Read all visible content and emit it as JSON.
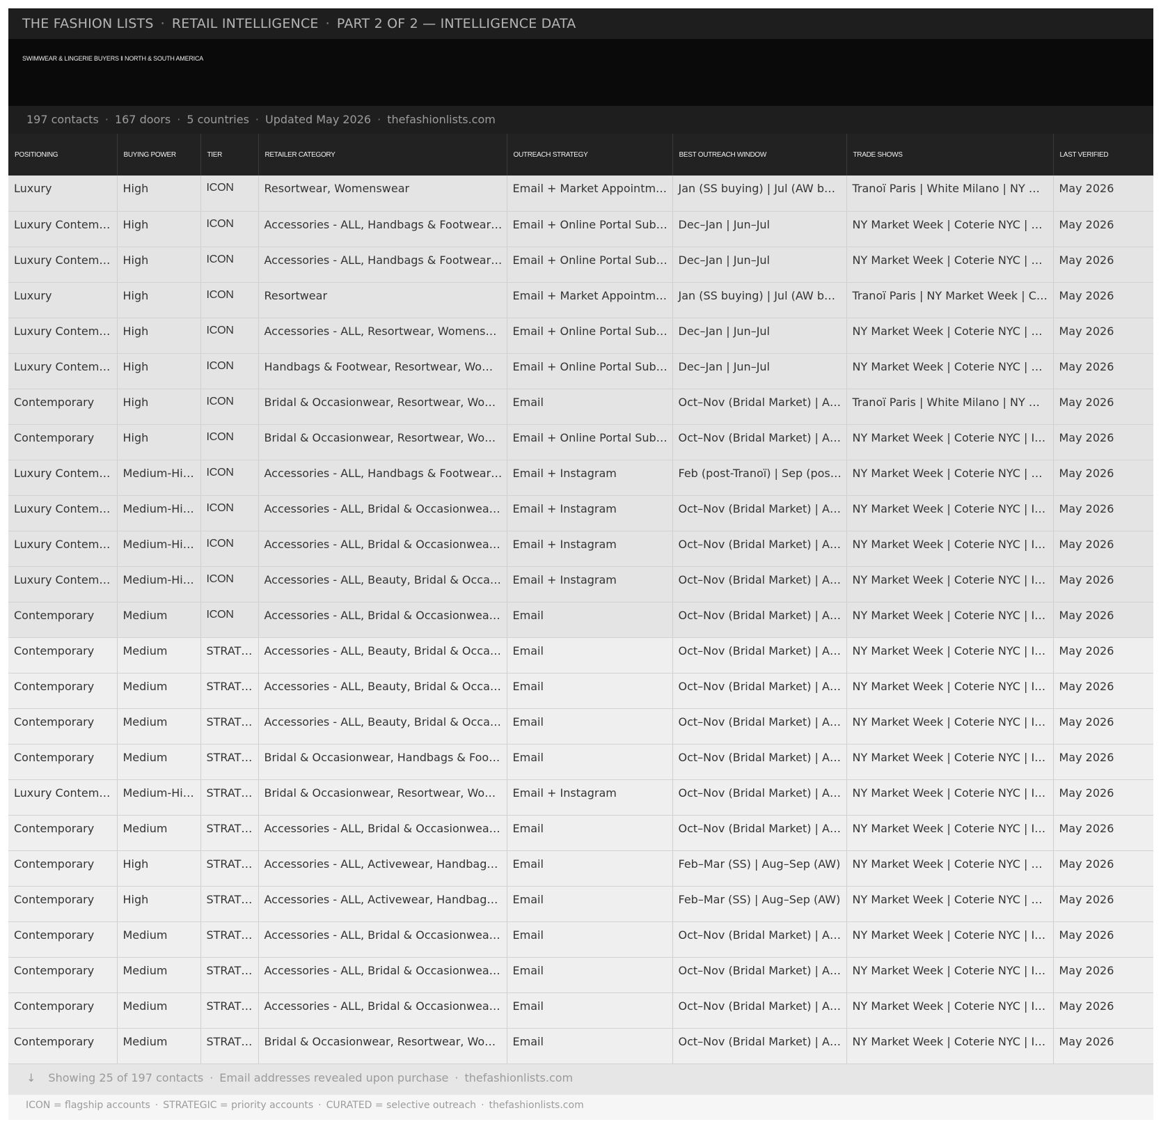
{
  "header": {
    "brand": "THE FASHION LISTS",
    "section": "RETAIL INTELLIGENCE",
    "part": "PART 2 OF 2 — INTELLIGENCE DATA",
    "separator": "·"
  },
  "banner": {
    "subtitle": "SWIMWEAR & LINGERIE BUYERS ‖ NORTH & SOUTH AMERICA"
  },
  "stats": {
    "contacts": "197 contacts",
    "doors": "167 doors",
    "countries": "5 countries",
    "updated": "Updated May 2026",
    "site": "thefashionlists.com",
    "separator": "·"
  },
  "table": {
    "columns": [
      "POSITIONING",
      "BUYING POWER",
      "TIER",
      "RETAILER CATEGORY",
      "OUTREACH STRATEGY",
      "BEST OUTREACH WINDOW",
      "TRADE SHOWS",
      "LAST VERIFIED"
    ],
    "rows": [
      {
        "positioning": "Luxury",
        "buying_power": "High",
        "tier": "ICON",
        "category": "Resortwear, Womenswear",
        "outreach": "Email + Market Appointm…",
        "window": "Jan (SS buying) | Jul (AW bu…",
        "trade_shows": "Tranoï Paris | White Milano | NY M…",
        "verified": "May 2026"
      },
      {
        "positioning": "Luxury Contem…",
        "buying_power": "High",
        "tier": "ICON",
        "category": "Accessories - ALL, Handbags & Footwear…",
        "outreach": "Email + Online Portal Sub…",
        "window": "Dec–Jan | Jun–Jul",
        "trade_shows": "NY Market Week | Coterie NYC | C…",
        "verified": "May 2026"
      },
      {
        "positioning": "Luxury Contem…",
        "buying_power": "High",
        "tier": "ICON",
        "category": "Accessories - ALL, Handbags & Footwear…",
        "outreach": "Email + Online Portal Sub…",
        "window": "Dec–Jan | Jun–Jul",
        "trade_shows": "NY Market Week | Coterie NYC | C…",
        "verified": "May 2026"
      },
      {
        "positioning": "Luxury",
        "buying_power": "High",
        "tier": "ICON",
        "category": "Resortwear",
        "outreach": "Email + Market Appointm…",
        "window": "Jan (SS buying) | Jul (AW bu…",
        "trade_shows": "Tranoï Paris | NY Market Week | C…",
        "verified": "May 2026"
      },
      {
        "positioning": "Luxury Contem…",
        "buying_power": "High",
        "tier": "ICON",
        "category": "Accessories - ALL, Resortwear, Womens…",
        "outreach": "Email + Online Portal Sub…",
        "window": "Dec–Jan | Jun–Jul",
        "trade_shows": "NY Market Week | Coterie NYC | C…",
        "verified": "May 2026"
      },
      {
        "positioning": "Luxury Contem…",
        "buying_power": "High",
        "tier": "ICON",
        "category": "Handbags & Footwear, Resortwear, Wom…",
        "outreach": "Email + Online Portal Sub…",
        "window": "Dec–Jan | Jun–Jul",
        "trade_shows": "NY Market Week | Coterie NYC | C…",
        "verified": "May 2026"
      },
      {
        "positioning": "Contemporary",
        "buying_power": "High",
        "tier": "ICON",
        "category": "Bridal & Occasionwear, Resortwear, Wo…",
        "outreach": "Email",
        "window": "Oct–Nov (Bridal Market) | A…",
        "trade_shows": "Tranoï Paris | White Milano | NY M…",
        "verified": "May 2026"
      },
      {
        "positioning": "Contemporary",
        "buying_power": "High",
        "tier": "ICON",
        "category": "Bridal & Occasionwear, Resortwear, Wo…",
        "outreach": "Email + Online Portal Sub…",
        "window": "Oct–Nov (Bridal Market) | A…",
        "trade_shows": "NY Market Week | Coterie NYC | I…",
        "verified": "May 2026"
      },
      {
        "positioning": "Luxury Contem…",
        "buying_power": "Medium-Hi…",
        "tier": "ICON",
        "category": "Accessories - ALL, Handbags & Footwear…",
        "outreach": "Email + Instagram",
        "window": "Feb (post-Tranoï) | Sep (pos…",
        "trade_shows": "NY Market Week | Coterie NYC | C…",
        "verified": "May 2026"
      },
      {
        "positioning": "Luxury Contem…",
        "buying_power": "Medium-Hi…",
        "tier": "ICON",
        "category": "Accessories - ALL, Bridal & Occasionwear…",
        "outreach": "Email + Instagram",
        "window": "Oct–Nov (Bridal Market) | A…",
        "trade_shows": "NY Market Week | Coterie NYC | I…",
        "verified": "May 2026"
      },
      {
        "positioning": "Luxury Contem…",
        "buying_power": "Medium-Hi…",
        "tier": "ICON",
        "category": "Accessories - ALL, Bridal & Occasionwear…",
        "outreach": "Email + Instagram",
        "window": "Oct–Nov (Bridal Market) | A…",
        "trade_shows": "NY Market Week | Coterie NYC | I…",
        "verified": "May 2026"
      },
      {
        "positioning": "Luxury Contem…",
        "buying_power": "Medium-Hi…",
        "tier": "ICON",
        "category": "Accessories - ALL, Beauty, Bridal & Occa…",
        "outreach": "Email + Instagram",
        "window": "Oct–Nov (Bridal Market) | A…",
        "trade_shows": "NY Market Week | Coterie NYC | I…",
        "verified": "May 2026"
      },
      {
        "positioning": "Contemporary",
        "buying_power": "Medium",
        "tier": "ICON",
        "category": "Accessories - ALL, Bridal & Occasionwear…",
        "outreach": "Email",
        "window": "Oct–Nov (Bridal Market) | A…",
        "trade_shows": "NY Market Week | Coterie NYC | I…",
        "verified": "May 2026"
      },
      {
        "positioning": "Contemporary",
        "buying_power": "Medium",
        "tier": "STRAT…",
        "category": "Accessories - ALL, Beauty, Bridal & Occa…",
        "outreach": "Email",
        "window": "Oct–Nov (Bridal Market) | A…",
        "trade_shows": "NY Market Week | Coterie NYC | I…",
        "verified": "May 2026"
      },
      {
        "positioning": "Contemporary",
        "buying_power": "Medium",
        "tier": "STRAT…",
        "category": "Accessories - ALL, Beauty, Bridal & Occa…",
        "outreach": "Email",
        "window": "Oct–Nov (Bridal Market) | A…",
        "trade_shows": "NY Market Week | Coterie NYC | I…",
        "verified": "May 2026"
      },
      {
        "positioning": "Contemporary",
        "buying_power": "Medium",
        "tier": "STRAT…",
        "category": "Accessories - ALL, Beauty, Bridal & Occa…",
        "outreach": "Email",
        "window": "Oct–Nov (Bridal Market) | A…",
        "trade_shows": "NY Market Week | Coterie NYC | I…",
        "verified": "May 2026"
      },
      {
        "positioning": "Contemporary",
        "buying_power": "Medium",
        "tier": "STRAT…",
        "category": "Bridal & Occasionwear, Handbags & Foot…",
        "outreach": "Email",
        "window": "Oct–Nov (Bridal Market) | A…",
        "trade_shows": "NY Market Week | Coterie NYC | I…",
        "verified": "May 2026"
      },
      {
        "positioning": "Luxury Contem…",
        "buying_power": "Medium-Hi…",
        "tier": "STRAT…",
        "category": "Bridal & Occasionwear, Resortwear, Wo…",
        "outreach": "Email + Instagram",
        "window": "Oct–Nov (Bridal Market) | A…",
        "trade_shows": "NY Market Week | Coterie NYC | I…",
        "verified": "May 2026"
      },
      {
        "positioning": "Contemporary",
        "buying_power": "Medium",
        "tier": "STRAT…",
        "category": "Accessories - ALL, Bridal & Occasionwear…",
        "outreach": "Email",
        "window": "Oct–Nov (Bridal Market) | A…",
        "trade_shows": "NY Market Week | Coterie NYC | I…",
        "verified": "May 2026"
      },
      {
        "positioning": "Contemporary",
        "buying_power": "High",
        "tier": "STRAT…",
        "category": "Accessories - ALL, Activewear, Handbags…",
        "outreach": "Email",
        "window": "Feb–Mar (SS) | Aug–Sep (AW)",
        "trade_shows": "NY Market Week | Coterie NYC | C…",
        "verified": "May 2026"
      },
      {
        "positioning": "Contemporary",
        "buying_power": "High",
        "tier": "STRAT…",
        "category": "Accessories - ALL, Activewear, Handbags…",
        "outreach": "Email",
        "window": "Feb–Mar (SS) | Aug–Sep (AW)",
        "trade_shows": "NY Market Week | Coterie NYC | C…",
        "verified": "May 2026"
      },
      {
        "positioning": "Contemporary",
        "buying_power": "Medium",
        "tier": "STRAT…",
        "category": "Accessories - ALL, Bridal & Occasionwear…",
        "outreach": "Email",
        "window": "Oct–Nov (Bridal Market) | A…",
        "trade_shows": "NY Market Week | Coterie NYC | I…",
        "verified": "May 2026"
      },
      {
        "positioning": "Contemporary",
        "buying_power": "Medium",
        "tier": "STRAT…",
        "category": "Accessories - ALL, Bridal & Occasionwear…",
        "outreach": "Email",
        "window": "Oct–Nov (Bridal Market) | A…",
        "trade_shows": "NY Market Week | Coterie NYC | I…",
        "verified": "May 2026"
      },
      {
        "positioning": "Contemporary",
        "buying_power": "Medium",
        "tier": "STRAT…",
        "category": "Accessories - ALL, Bridal & Occasionwear…",
        "outreach": "Email",
        "window": "Oct–Nov (Bridal Market) | A…",
        "trade_shows": "NY Market Week | Coterie NYC | I…",
        "verified": "May 2026"
      },
      {
        "positioning": "Contemporary",
        "buying_power": "Medium",
        "tier": "STRAT…",
        "category": "Bridal & Occasionwear, Resortwear, Wo…",
        "outreach": "Email",
        "window": "Oct–Nov (Bridal Market) | A…",
        "trade_shows": "NY Market Week | Coterie NYC | I…",
        "verified": "May 2026"
      }
    ]
  },
  "footer": {
    "arrow": "↓",
    "showing": "Showing 25 of 197 contacts",
    "reveal_note": "Email addresses revealed upon purchase",
    "site": "thefashionlists.com",
    "separator": "·"
  },
  "legend": {
    "icon": "ICON = flagship accounts",
    "strategic": "STRATEGIC = priority accounts",
    "curated": "CURATED = selective outreach",
    "site": "thefashionlists.com",
    "separator": "·"
  },
  "colors": {
    "title_bar_bg": "#1e1e1e",
    "banner_bg": "#0a0a0a",
    "header_row_bg": "#222222",
    "icon_row_bg": "#e4e4e4",
    "strategic_row_bg": "#efefef",
    "footer_bg": "#e6e6e6"
  }
}
